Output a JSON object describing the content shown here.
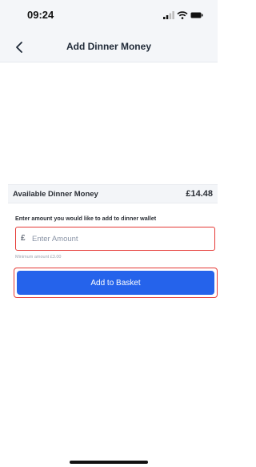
{
  "status_bar": {
    "time": "09:24",
    "icons": [
      "signal-icon",
      "wifi-icon",
      "battery-icon"
    ]
  },
  "nav": {
    "back_icon": "chevron-left-icon",
    "title": "Add Dinner Money"
  },
  "balance": {
    "label": "Available Dinner Money",
    "value": "£14.48"
  },
  "amount": {
    "label": "Enter amount you would like to add to dinner wallet",
    "currency_symbol": "£",
    "placeholder": "Enter Amount",
    "value": "",
    "hint": "Minimum amount £3.00"
  },
  "actions": {
    "add_to_basket_label": "Add to Basket"
  },
  "colors": {
    "primary": "#2563eb",
    "highlight": "#e53935",
    "header_background": "#f4f6f9"
  }
}
